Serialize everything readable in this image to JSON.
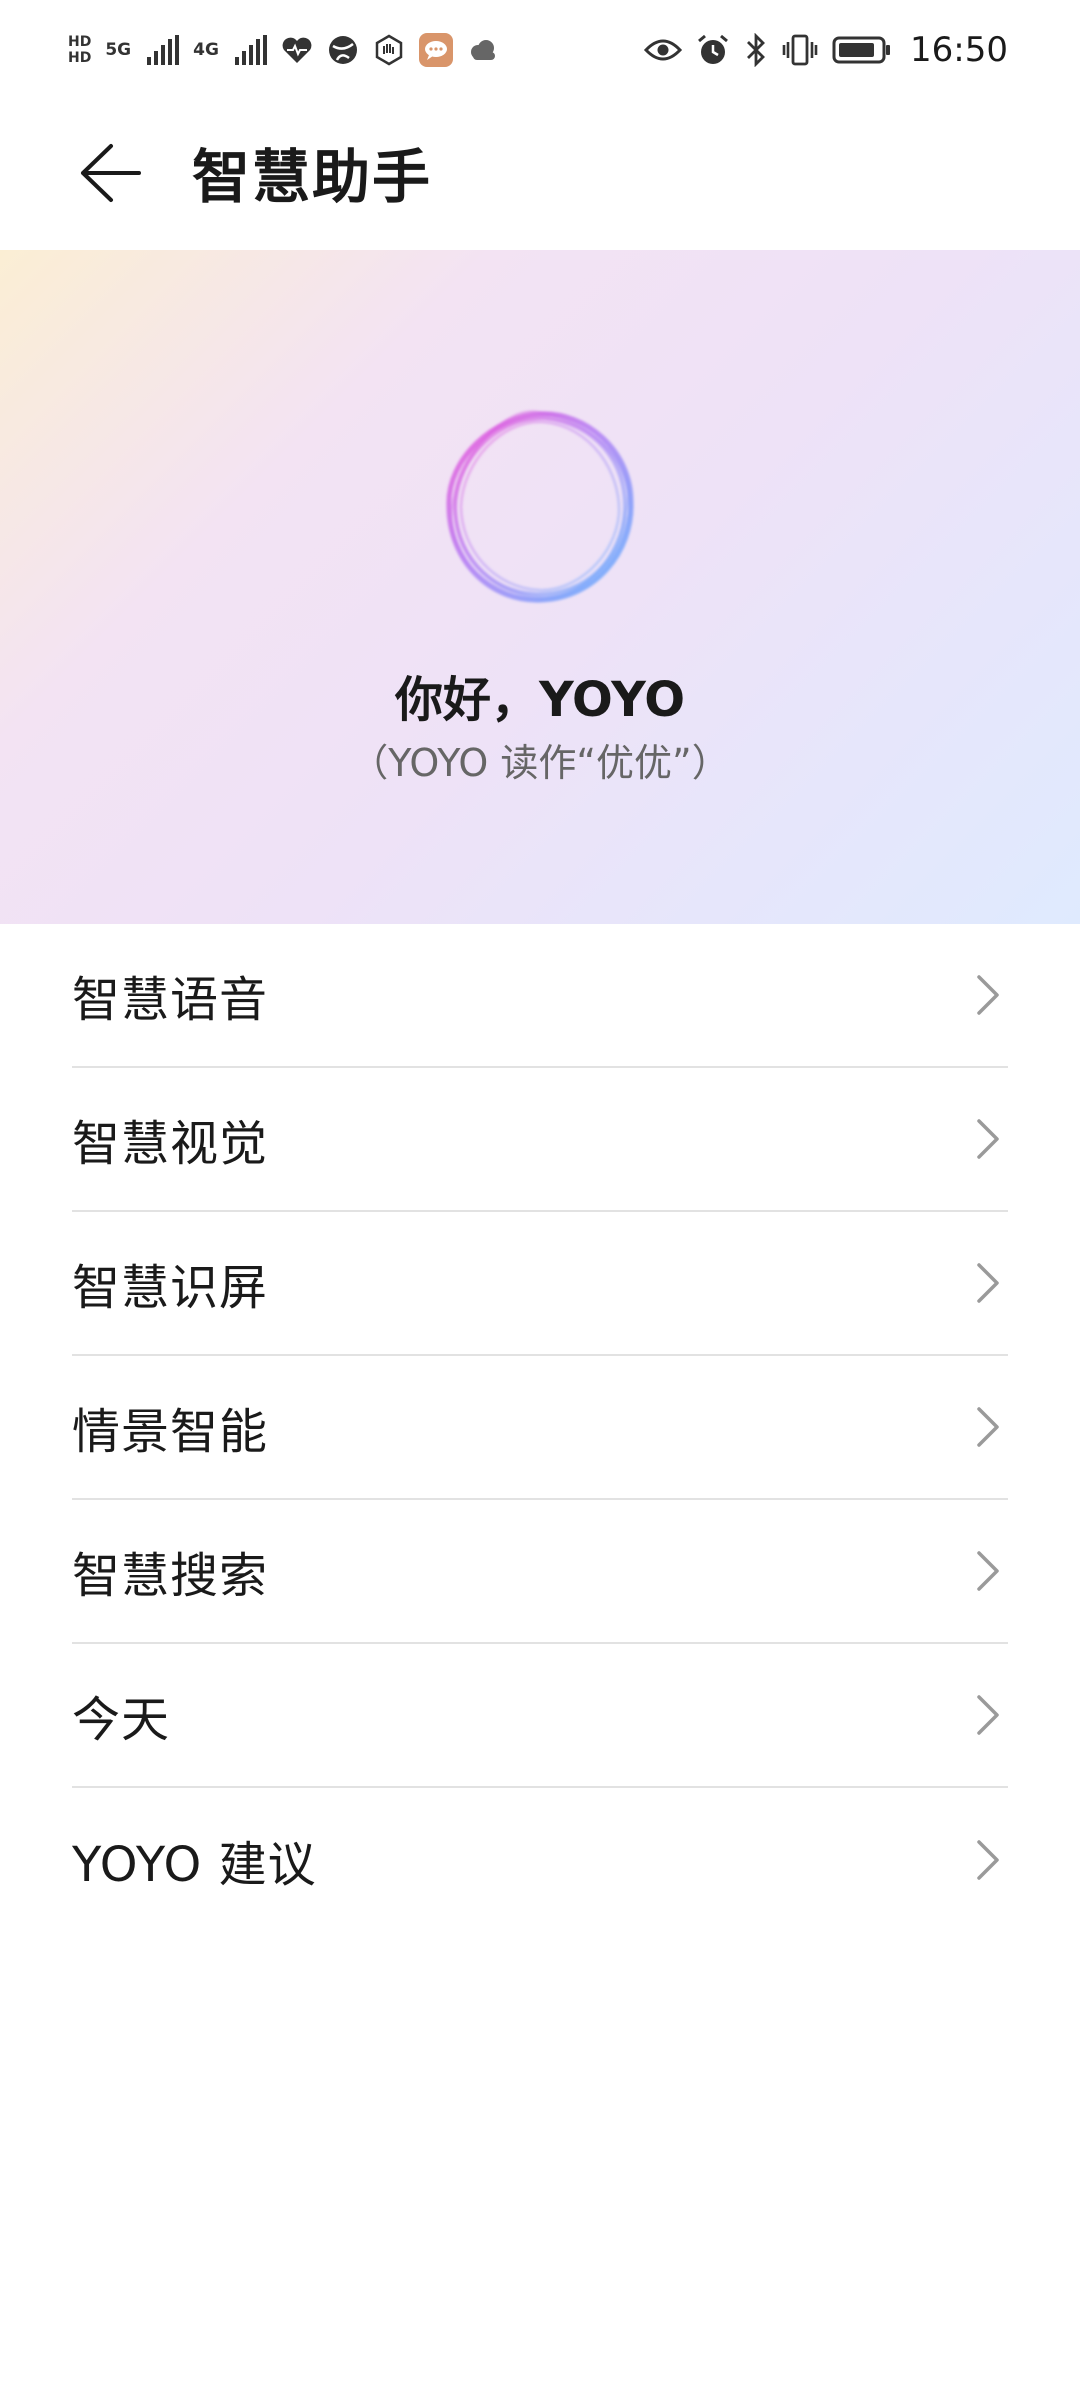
{
  "status_bar": {
    "hd1": "HD",
    "hd2": "HD",
    "net1": "5G",
    "net2": "4G",
    "time": "16:50"
  },
  "header": {
    "title": "智慧助手"
  },
  "hero": {
    "greeting": "你好，YOYO",
    "pronunciation": "（YOYO 读作“优优”）"
  },
  "menu": {
    "items": [
      {
        "label": "智慧语音"
      },
      {
        "label": "智慧视觉"
      },
      {
        "label": "智慧识屏"
      },
      {
        "label": "情景智能"
      },
      {
        "label": "智慧搜索"
      },
      {
        "label": "今天"
      },
      {
        "label": "YOYO 建议"
      }
    ]
  },
  "colors": {
    "text_primary": "#1a1a1a",
    "text_secondary": "#666666",
    "divider": "#e2e2e2",
    "chevron": "#9a9a9a",
    "orb_pink": "#e45de4",
    "orb_blue": "#6fb0ff"
  }
}
